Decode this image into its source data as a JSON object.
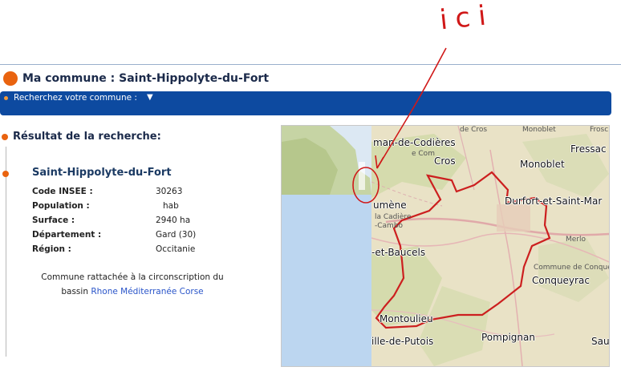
{
  "annotation": {
    "handwritten_text": "ici"
  },
  "header": {
    "title": "Ma commune : Saint-Hippolyte-du-Fort"
  },
  "search": {
    "label": "Recherchez votre commune :",
    "arrow": "▼"
  },
  "result": {
    "heading": "Résultat de la recherche:",
    "commune_name": "Saint-Hippolyte-du-Fort",
    "fields": [
      {
        "label": "Code INSEE :",
        "value": "30263"
      },
      {
        "label": "Population :",
        "value": "hab"
      },
      {
        "label": "Surface :",
        "value": "2940 ha"
      },
      {
        "label": "Département :",
        "value": "Gard (30)"
      },
      {
        "label": "Région :",
        "value": "Occitanie"
      }
    ],
    "note_line1": "Commune rattachée à la circonscription du",
    "note_prefix": "bassin",
    "note_link": "Rhone Méditerranée Corse"
  },
  "map": {
    "labels": {
      "cros": "Cros",
      "codieres": "man-de-Codières",
      "monoblet": "Monoblet",
      "fressac": "Fressac",
      "durfort": "Durfort-et-Saint-Mar",
      "sumene": "umène",
      "baucels": "-et-Baucels",
      "conqueyrac": "Conqueyrac",
      "montoulieu": "Montoulieu",
      "putois": "ille-de-Putois",
      "pompignan": "Pompignan",
      "sau": "Sau",
      "cadiere": "la Cadière",
      "cambo": "-Cambo",
      "merlo": "Merlo",
      "conqueyrac_small": "Commune de Conque",
      "monoblet_small": "Monoblet",
      "frosc": "Frosc",
      "cros_small": "de Cros",
      "com": "e Com"
    }
  }
}
